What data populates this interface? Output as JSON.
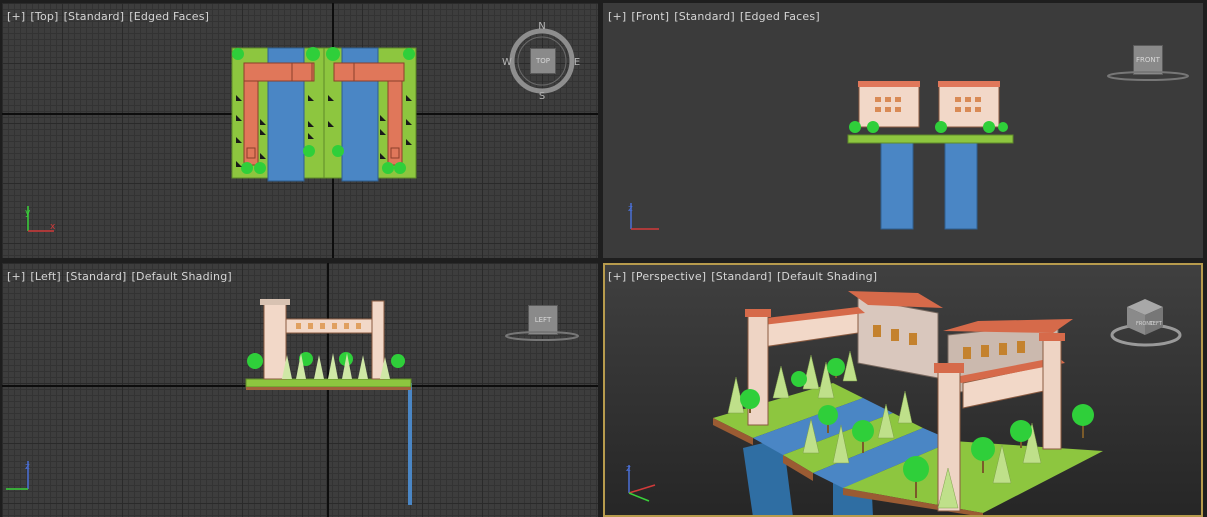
{
  "viewports": {
    "top": {
      "labels": [
        "[+]",
        "[Top]",
        "[Standard]",
        "[Edged Faces]"
      ],
      "viewcube": "TOP",
      "compass": {
        "n": "N",
        "s": "S",
        "e": "E",
        "w": "W"
      }
    },
    "front": {
      "labels": [
        "[+]",
        "[Front]",
        "[Standard]",
        "[Edged Faces]"
      ],
      "viewcube": "FRONT"
    },
    "left": {
      "labels": [
        "[+]",
        "[Left]",
        "[Standard]",
        "[Default Shading]"
      ],
      "viewcube": "LEFT"
    },
    "perspective": {
      "labels": [
        "[+]",
        "[Perspective]",
        "[Standard]",
        "[Default Shading]"
      ],
      "viewcube_front": "FRONT",
      "viewcube_left": "LEFT"
    }
  },
  "axis_tripod": {
    "x": "x",
    "y": "y",
    "z": "z"
  },
  "colors": {
    "grass": "#8dc63f",
    "water": "#4a86c5",
    "roof": "#e0775a",
    "wall": "#f2d8c8",
    "tree": "#2fcf3a",
    "active_border": "#b79b4d"
  },
  "icons": [
    "viewcube-icon",
    "compass-ring-icon",
    "axis-tripod-icon"
  ]
}
